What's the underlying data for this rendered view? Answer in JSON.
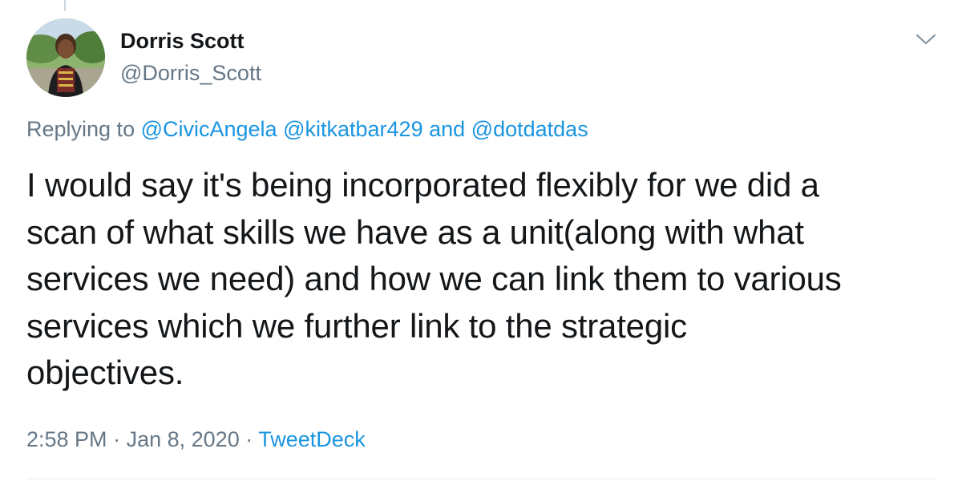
{
  "tweet": {
    "author": {
      "name": "Dorris Scott",
      "handle": "@Dorris_Scott",
      "avatar_icon": "profile-photo"
    },
    "menu_icon": "chevron-down-icon",
    "reply_context": {
      "prefix": "Replying to ",
      "mentions": [
        "@CivicAngela",
        "@kitkatbar429",
        "@dotdatdas"
      ],
      "conjunction": "and"
    },
    "text": "I would say it's being incorporated flexibly for we did a\nscan of what skills we have as a unit(along with what\nservices we need) and how we can link them to various\nservices which we further link to the strategic\nobjectives.",
    "meta": {
      "time": "2:58 PM",
      "separator": "·",
      "date": "Jan 8, 2020",
      "source": "TweetDeck"
    }
  },
  "colors": {
    "link": "#1b95e0",
    "secondary_text": "#657786",
    "primary_text": "#14171a",
    "divider": "#e6ecf0"
  }
}
